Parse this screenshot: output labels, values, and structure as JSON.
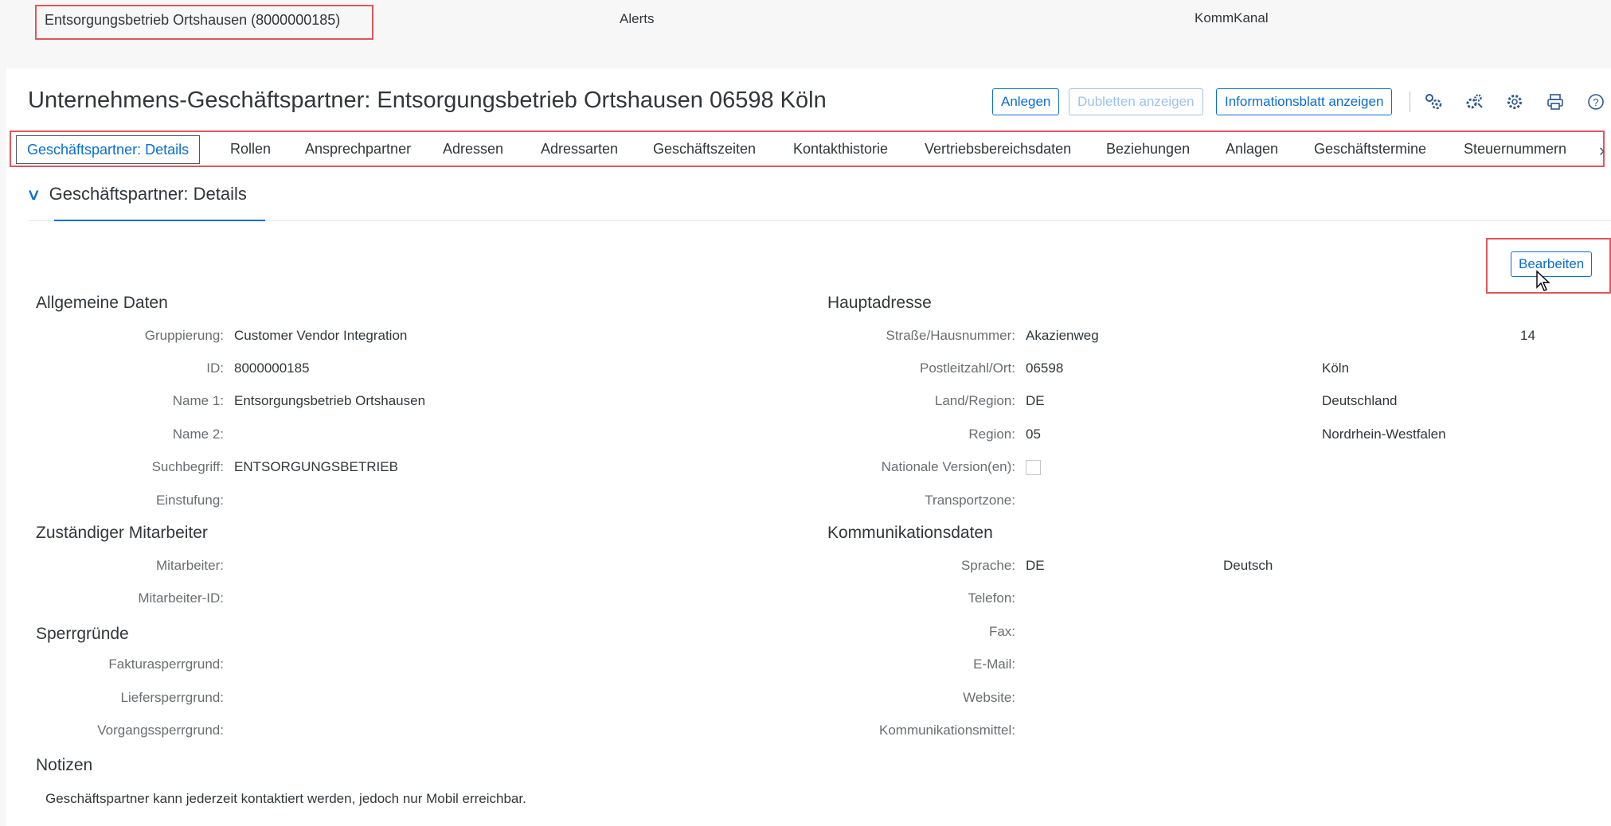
{
  "header": {
    "context": "Entsorgungsbetrieb Ortshausen (8000000185)",
    "alerts": "Alerts",
    "kommkanal": "KommKanal"
  },
  "page": {
    "title": "Unternehmens-Geschäftspartner: Entsorgungsbetrieb Ortshausen 06598 Köln",
    "buttons": {
      "anlegen": "Anlegen",
      "dubletten": "Dubletten anzeigen",
      "infoblatt": "Informationsblatt anzeigen"
    }
  },
  "tabs": [
    "Geschäftspartner: Details",
    "Rollen",
    "Ansprechpartner",
    "Adressen",
    "Adressarten",
    "Geschäftszeiten",
    "Kontakthistorie",
    "Vertriebsbereichsdaten",
    "Beziehungen",
    "Anlagen",
    "Geschäftstermine",
    "Steuernummern"
  ],
  "section": {
    "title": "Geschäftspartner: Details",
    "edit": "Bearbeiten"
  },
  "allgemein": {
    "title": "Allgemeine Daten",
    "gruppierung_label": "Gruppierung:",
    "gruppierung": "Customer Vendor Integration",
    "id_label": "ID:",
    "id": "8000000185",
    "name1_label": "Name 1:",
    "name1": "Entsorgungsbetrieb Ortshausen",
    "name2_label": "Name 2:",
    "suchbegriff_label": "Suchbegriff:",
    "suchbegriff": "ENTSORGUNGSBETRIEB",
    "einstufung_label": "Einstufung:"
  },
  "mitarbeiter": {
    "title": "Zuständiger Mitarbeiter",
    "mitarbeiter_label": "Mitarbeiter:",
    "id_label": "Mitarbeiter-ID:"
  },
  "sperr": {
    "title": "Sperrgründe",
    "faktura_label": "Fakturasperrgrund:",
    "liefer_label": "Liefersperrgrund:",
    "vorgang_label": "Vorgangssperrgrund:"
  },
  "notizen": {
    "title": "Notizen",
    "text": "Geschäftspartner kann jederzeit kontaktiert werden, jedoch nur Mobil erreichbar."
  },
  "adresse": {
    "title": "Hauptadresse",
    "strasse_label": "Straße/Hausnummer:",
    "strasse": "Akazienweg",
    "hausnummer": "14",
    "plz_label": "Postleitzahl/Ort:",
    "plz": "06598",
    "ort": "Köln",
    "land_label": "Land/Region:",
    "land": "DE",
    "land_text": "Deutschland",
    "region_label": "Region:",
    "region": "05",
    "region_text": "Nordrhein-Westfalen",
    "national_label": "Nationale Version(en):",
    "transport_label": "Transportzone:"
  },
  "komm": {
    "title": "Kommunikationsdaten",
    "sprache_label": "Sprache:",
    "sprache": "DE",
    "sprache_text": "Deutsch",
    "telefon_label": "Telefon:",
    "fax_label": "Fax:",
    "email_label": "E-Mail:",
    "website_label": "Website:",
    "mittel_label": "Kommunikationsmittel:"
  },
  "colors": {
    "accent": "#0a6ed1",
    "highlight": "#e0565e"
  }
}
